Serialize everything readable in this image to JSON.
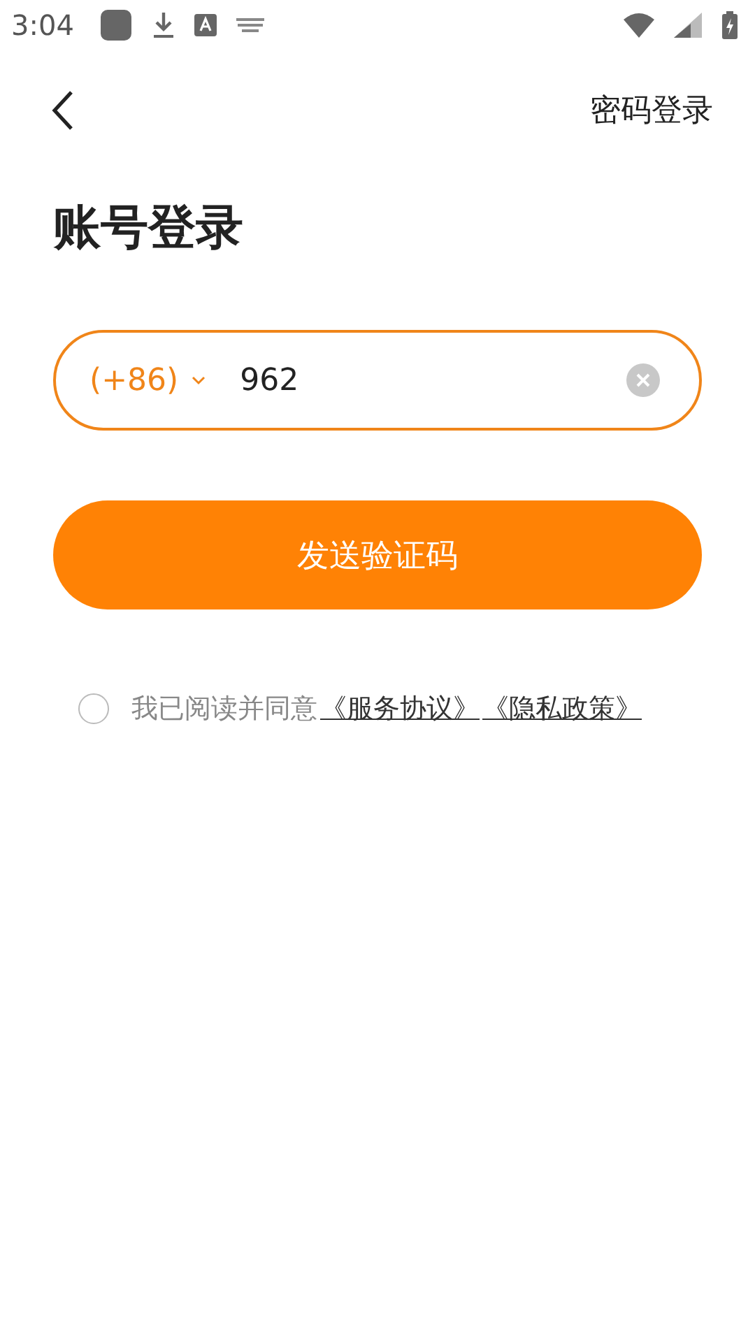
{
  "status_bar": {
    "time": "3:04"
  },
  "header": {
    "action": "密码登录"
  },
  "title": "账号登录",
  "phone_field": {
    "country_code": "(+86)",
    "value": "962"
  },
  "send_button": "发送验证码",
  "agreement": {
    "checked": false,
    "text": "我已阅读并同意",
    "links": [
      "《服务协议》",
      "《隐私政策》"
    ]
  }
}
